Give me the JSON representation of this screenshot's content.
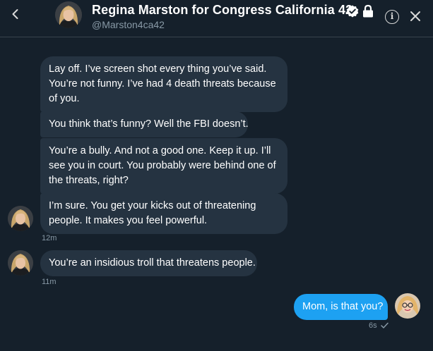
{
  "header": {
    "name": "Regina Marston for Congress California 42",
    "handle": "@Marston4ca42",
    "verified_icon": "verified-badge-icon",
    "protected_icon": "lock-icon",
    "accent": "#1da1f2"
  },
  "messages": [
    {
      "text": "Lay off. I’ve screen shot every thing you’ve said. You’re not funny. I’ve had 4 death threats because of you.",
      "side": "in"
    },
    {
      "text": "You think that’s funny? Well the FBI doesn’t.",
      "side": "in"
    },
    {
      "text": "You’re a bully. And not a good one. Keep it up. I’ll see you in court. You probably were behind one of the threats, right?",
      "side": "in"
    },
    {
      "text": "I’m sure. You get your kicks out of threatening people. It makes you feel powerful.",
      "side": "in"
    },
    {
      "text": "You’re an insidious troll that threatens people.",
      "side": "in"
    },
    {
      "text": "Mom, is that you?",
      "side": "out"
    }
  ],
  "timestamps": {
    "group1": "12m",
    "group2": "11m",
    "outgoing": "6s",
    "seen_icon": "check-icon"
  }
}
